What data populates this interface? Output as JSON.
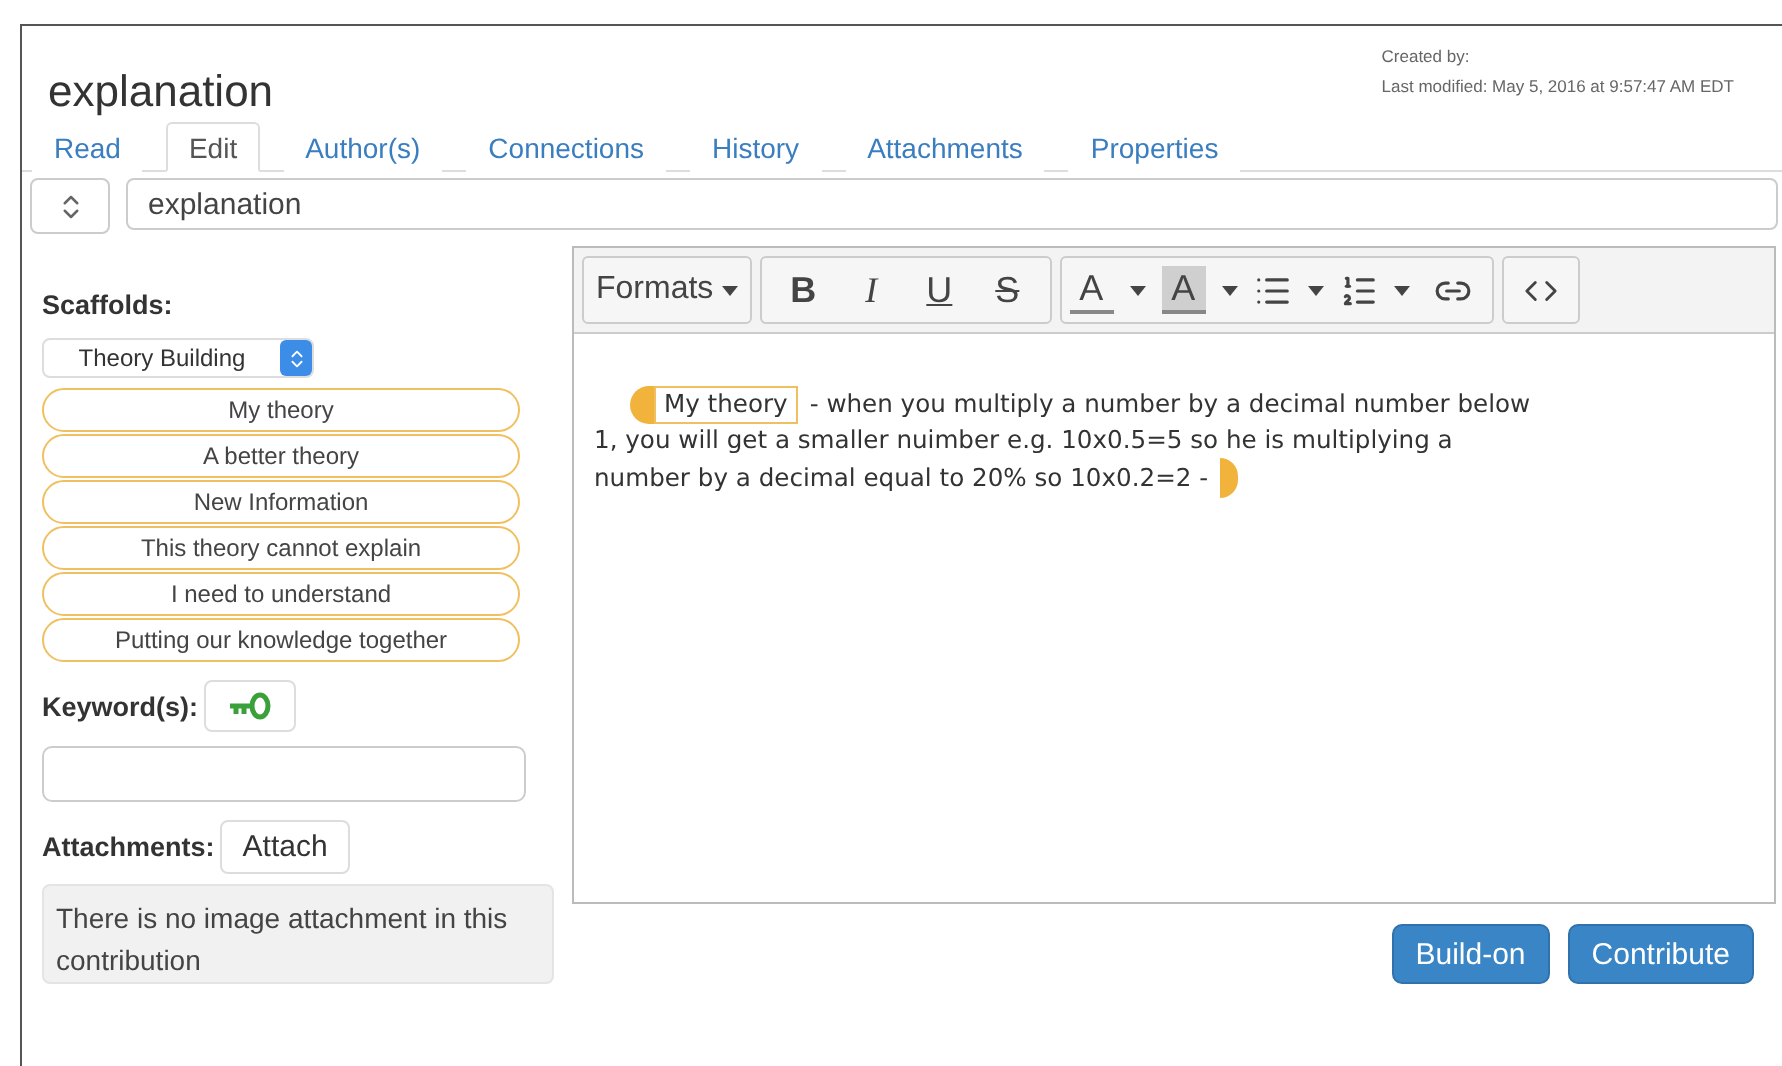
{
  "title": "explanation",
  "meta": {
    "created": "Created by:",
    "modified": "Last modified: May 5, 2016 at 9:57:47 AM EDT"
  },
  "tabs": [
    {
      "label": "Read",
      "selected": false
    },
    {
      "label": "Edit",
      "selected": true
    },
    {
      "label": "Author(s)",
      "selected": false
    },
    {
      "label": "Connections",
      "selected": false
    },
    {
      "label": "History",
      "selected": false
    },
    {
      "label": "Attachments",
      "selected": false
    },
    {
      "label": "Properties",
      "selected": false
    }
  ],
  "title_field": {
    "value": "explanation"
  },
  "scaffolds": {
    "label": "Scaffolds:",
    "select": "Theory Building",
    "items": [
      "My theory",
      "A better theory",
      "New Information",
      "This theory cannot explain",
      "I need to understand",
      "Putting our knowledge together"
    ]
  },
  "keywords": {
    "label": "Keyword(s):"
  },
  "attachments": {
    "label": "Attachments:",
    "button": "Attach",
    "message": "There is no image attachment in this contribution"
  },
  "toolbar": [
    [
      {
        "kind": "menu",
        "label": "Formats"
      }
    ],
    [
      {
        "kind": "bold",
        "label": "B"
      },
      {
        "kind": "italic",
        "label": "I"
      },
      {
        "kind": "underline",
        "label": "U"
      },
      {
        "kind": "strike",
        "label": "S"
      }
    ],
    [
      {
        "kind": "textcolor",
        "label": "A"
      },
      {
        "kind": "caret"
      },
      {
        "kind": "highlight",
        "label": "A"
      },
      {
        "kind": "caret"
      },
      {
        "kind": "bullets"
      },
      {
        "kind": "caret"
      },
      {
        "kind": "numbers"
      },
      {
        "kind": "caret"
      },
      {
        "kind": "link"
      }
    ],
    [
      {
        "kind": "code"
      }
    ]
  ],
  "editor": {
    "tag": "My theory",
    "lines": [
      "- when you multiply a number by a decimal number below",
      "1, you will get a smaller nuimber e.g. 10x0.5=5 so he is multiplying a",
      "number by a decimal equal to 20% so 10x0.2=2 -"
    ]
  },
  "buttons": [
    "Build-on",
    "Contribute"
  ]
}
